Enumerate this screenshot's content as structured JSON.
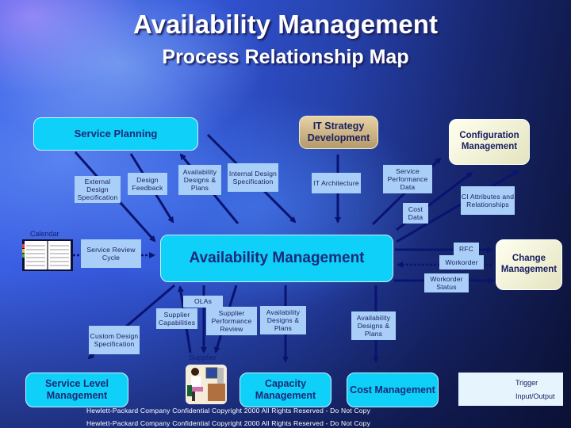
{
  "title": "Availability Management",
  "subtitle": "Process Relationship Map",
  "processes": {
    "service_planning": "Service Planning",
    "it_strategy": "IT Strategy Development",
    "configuration": "Configuration Management",
    "availability": "Availability Management",
    "change": "Change Management",
    "service_level": "Service Level Management",
    "capacity": "Capacity Management",
    "cost": "Cost Management"
  },
  "labels": {
    "external_design_spec": "External Design Specification",
    "design_feedback": "Design Feedback",
    "avail_designs_plans_top": "Availability Designs & Plans",
    "internal_design_spec": "Internal Design Specification",
    "it_architecture": "IT Architecture",
    "service_perf_data": "Service Performance Data",
    "cost_data": "Cost Data",
    "ci_attributes": "CI Attributes and Relationships",
    "service_review_cycle": "Service Review Cycle",
    "rfc": "RFC",
    "workorder": "Workorder",
    "workorder_status": "Workorder Status",
    "olas": "OLAs",
    "supplier_capabilities": "Supplier Capabilities",
    "supplier_perf_review": "Supplier Performance Review",
    "avail_designs_plans_capacity": "Availability Designs & Plans",
    "avail_designs_plans_cost": "Availability Designs & Plans",
    "custom_design_spec": "Custom Design Specification"
  },
  "entities": {
    "calendar": "Calendar",
    "supplier": "Supplier"
  },
  "legend": {
    "trigger": "Trigger",
    "input_output": "Input/Output"
  },
  "footer": {
    "line1": "Hewlett-Packard Company Confidential Copyright 2000 All Rights Reserved - Do Not Copy",
    "line2": "Hewlett-Packard Company Confidential Copyright 2000 All Rights Reserved - Do Not Copy"
  },
  "colors": {
    "process_cyan": "#0fd0f8",
    "label_blue": "#a9cff8",
    "arrow_navy": "#0a1470",
    "text_navy": "#1a2a7a"
  }
}
